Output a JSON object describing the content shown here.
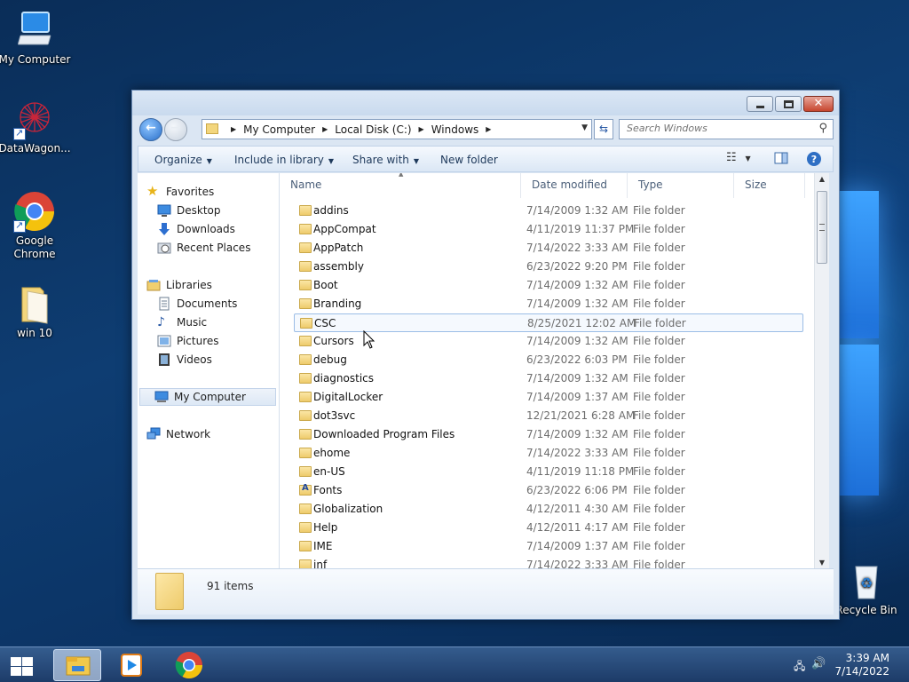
{
  "desktop": {
    "icons": [
      {
        "label": "My Computer"
      },
      {
        "label": "DataWagon..."
      },
      {
        "label": "Google Chrome"
      },
      {
        "label": "win 10"
      },
      {
        "label": "Recycle Bin"
      }
    ]
  },
  "window": {
    "breadcrumb": [
      "My Computer",
      "Local Disk (C:)",
      "Windows"
    ],
    "search_placeholder": "Search Windows",
    "toolbar": {
      "organize": "Organize",
      "include_in_library": "Include in library",
      "share_with": "Share with",
      "new_folder": "New folder"
    },
    "nav": {
      "favorites": "Favorites",
      "desktop": "Desktop",
      "downloads": "Downloads",
      "recent_places": "Recent Places",
      "libraries": "Libraries",
      "documents": "Documents",
      "music": "Music",
      "pictures": "Pictures",
      "videos": "Videos",
      "my_computer": "My Computer",
      "network": "Network"
    },
    "columns": {
      "name": "Name",
      "date": "Date modified",
      "type": "Type",
      "size": "Size"
    },
    "files": [
      {
        "name": "addins",
        "date": "7/14/2009 1:32 AM",
        "type": "File folder"
      },
      {
        "name": "AppCompat",
        "date": "4/11/2019 11:37 PM",
        "type": "File folder"
      },
      {
        "name": "AppPatch",
        "date": "7/14/2022 3:33 AM",
        "type": "File folder"
      },
      {
        "name": "assembly",
        "date": "6/23/2022 9:20 PM",
        "type": "File folder"
      },
      {
        "name": "Boot",
        "date": "7/14/2009 1:32 AM",
        "type": "File folder"
      },
      {
        "name": "Branding",
        "date": "7/14/2009 1:32 AM",
        "type": "File folder"
      },
      {
        "name": "CSC",
        "date": "8/25/2021 12:02 AM",
        "type": "File folder"
      },
      {
        "name": "Cursors",
        "date": "7/14/2009 1:32 AM",
        "type": "File folder"
      },
      {
        "name": "debug",
        "date": "6/23/2022 6:03 PM",
        "type": "File folder"
      },
      {
        "name": "diagnostics",
        "date": "7/14/2009 1:32 AM",
        "type": "File folder"
      },
      {
        "name": "DigitalLocker",
        "date": "7/14/2009 1:37 AM",
        "type": "File folder"
      },
      {
        "name": "dot3svc",
        "date": "12/21/2021 6:28 AM",
        "type": "File folder"
      },
      {
        "name": "Downloaded Program Files",
        "date": "7/14/2009 1:32 AM",
        "type": "File folder"
      },
      {
        "name": "ehome",
        "date": "7/14/2022 3:33 AM",
        "type": "File folder"
      },
      {
        "name": "en-US",
        "date": "4/11/2019 11:18 PM",
        "type": "File folder"
      },
      {
        "name": "Fonts",
        "date": "6/23/2022 6:06 PM",
        "type": "File folder"
      },
      {
        "name": "Globalization",
        "date": "4/12/2011 4:30 AM",
        "type": "File folder"
      },
      {
        "name": "Help",
        "date": "4/12/2011 4:17 AM",
        "type": "File folder"
      },
      {
        "name": "IME",
        "date": "7/14/2009 1:37 AM",
        "type": "File folder"
      },
      {
        "name": "inf",
        "date": "7/14/2022 3:33 AM",
        "type": "File folder"
      }
    ],
    "item_count": "91 items"
  },
  "taskbar": {
    "time": "3:39 AM",
    "date": "7/14/2022"
  }
}
